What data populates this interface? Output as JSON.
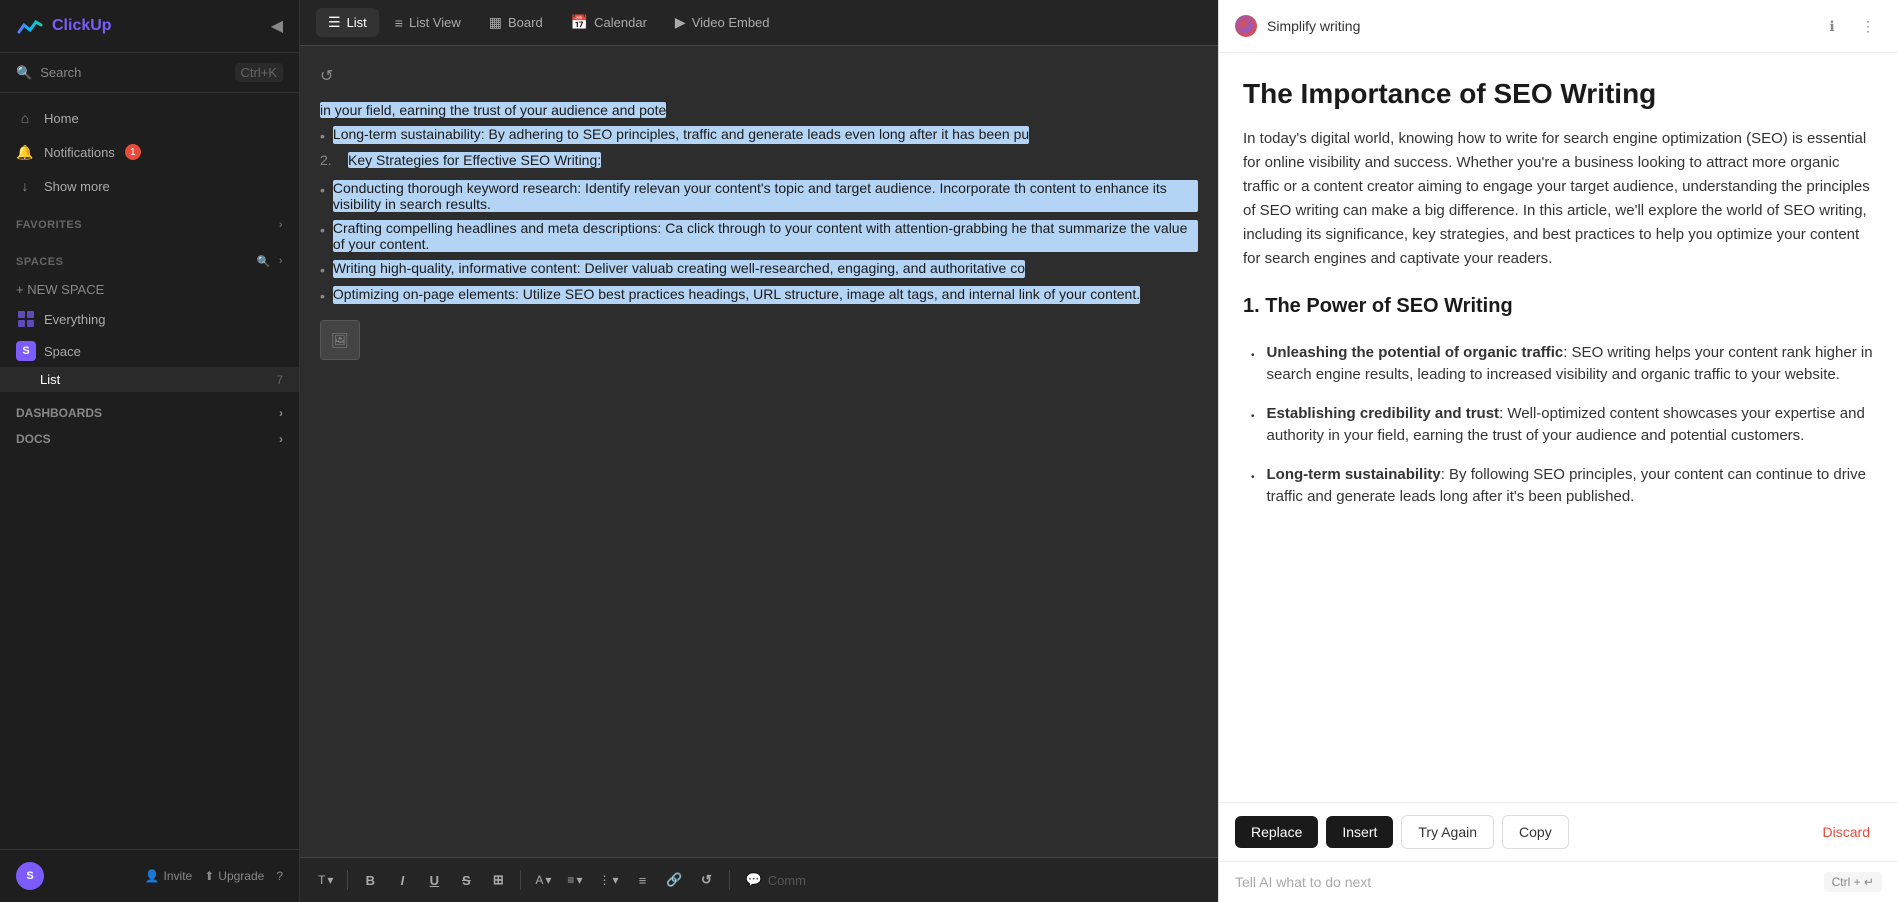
{
  "sidebar": {
    "logo": "ClickUp",
    "collapse_icon": "◀",
    "search_placeholder": "Search",
    "search_shortcut": "Ctrl+K",
    "nav_items": [
      {
        "id": "home",
        "label": "Home",
        "icon": "⌂"
      },
      {
        "id": "notifications",
        "label": "Notifications",
        "icon": "🔔",
        "badge": "1"
      },
      {
        "id": "show-more",
        "label": "Show more",
        "icon": "↓"
      }
    ],
    "favorites_label": "FAVORITES",
    "spaces_label": "SPACES",
    "new_space_label": "+ NEW SPACE",
    "spaces": [
      {
        "id": "everything",
        "label": "Everything",
        "icon": "⊞",
        "type": "everything"
      },
      {
        "id": "space",
        "label": "Space",
        "icon": "S",
        "type": "space"
      }
    ],
    "list_item": {
      "label": "List",
      "count": "7"
    },
    "dashboards_label": "DASHBOARDS",
    "docs_label": "DOCS",
    "bottom": {
      "avatar_initials": "S",
      "invite_label": "Invite",
      "upgrade_label": "Upgrade",
      "help_icon": "?"
    }
  },
  "tabs": [
    {
      "id": "list",
      "label": "List",
      "icon": "☰",
      "active": true
    },
    {
      "id": "list-view",
      "label": "List View",
      "icon": "≡"
    },
    {
      "id": "board",
      "label": "Board",
      "icon": "▦"
    },
    {
      "id": "calendar",
      "label": "Calendar",
      "icon": "📅"
    },
    {
      "id": "video-embed",
      "label": "Video Embed",
      "icon": "▶"
    }
  ],
  "editor": {
    "refresh_icon": "↺",
    "content": {
      "intro_text": "in your field, earning the trust of your audience and pote",
      "bullet1": "Long-term sustainability: By adhering to SEO principles, traffic and generate leads even long after it has been pu",
      "numbered_item": "Key Strategies for Effective SEO Writing:",
      "bullet2": "Conducting thorough keyword research: Identify relevan your content's topic and target audience. Incorporate th content to enhance its visibility in search results.",
      "bullet3": "Crafting compelling headlines and meta descriptions: Ca click through to your content with attention-grabbing he that summarize the value of your content.",
      "bullet4": "Writing high-quality, informative content: Deliver valuab creating well-researched, engaging, and authoritative co",
      "bullet5": "Optimizing on-page elements: Utilize SEO best practices headings, URL structure, image alt tags, and internal link of your content."
    },
    "toolbar": {
      "text_format": "T",
      "bold": "B",
      "italic": "I",
      "underline": "U",
      "strikethrough": "S",
      "table": "⊞",
      "color": "A",
      "align": "≡",
      "list": "⋮",
      "outdent": "≡",
      "link": "🔗",
      "undo": "↺",
      "comment_placeholder": "Comm"
    }
  },
  "ai_panel": {
    "title": "Simplify writing",
    "info_icon": "ℹ",
    "menu_icon": "⋮",
    "main_title": "The Importance of SEO Writing",
    "intro": "In today's digital world, knowing how to write for search engine optimization (SEO) is essential for online visibility and success. Whether you're a business looking to attract more organic traffic or a content creator aiming to engage your target audience, understanding the principles of SEO writing can make a big difference. In this article, we'll explore the world of SEO writing, including its significance, key strategies, and best practices to help you optimize your content for search engines and captivate your readers.",
    "section1_title": "1. The Power of SEO Writing",
    "bullets": [
      {
        "bold": "Unleashing the potential of organic traffic",
        "text": ": SEO writing helps your content rank higher in search engine results, leading to increased visibility and organic traffic to your website."
      },
      {
        "bold": "Establishing credibility and trust",
        "text": ": Well-optimized content showcases your expertise and authority in your field, earning the trust of your audience and potential customers."
      },
      {
        "bold": "Long-term sustainability",
        "text": ": By following SEO principles, your content can continue to drive traffic and generate leads long after it's been published."
      }
    ],
    "actions": {
      "replace": "Replace",
      "insert": "Insert",
      "try_again": "Try Again",
      "copy": "Copy",
      "discard": "Discard"
    },
    "input_placeholder": "Tell AI what to do next",
    "input_shortcut": "Ctrl + ↵"
  }
}
